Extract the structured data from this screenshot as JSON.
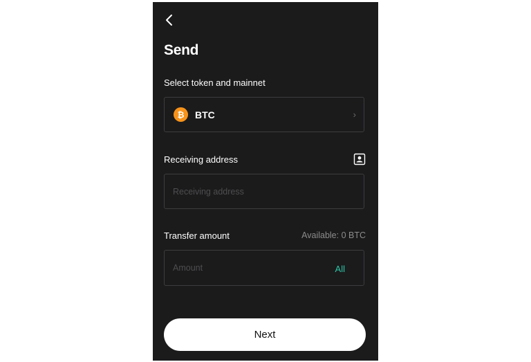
{
  "header": {
    "back_icon": "chevron-left-icon",
    "title": "Send"
  },
  "token": {
    "section_label": "Select token and mainnet",
    "symbol": "BTC",
    "icon": "bitcoin-icon",
    "icon_glyph": "₿",
    "chevron": "›",
    "accent_color": "#f7931a"
  },
  "address": {
    "section_label": "Receiving address",
    "placeholder": "Receiving address",
    "contact_icon": "address-book-icon"
  },
  "amount": {
    "section_label": "Transfer amount",
    "available_text": "Available: 0 BTC",
    "placeholder": "Amount",
    "all_label": "All",
    "all_color": "#2ec4a6"
  },
  "footer": {
    "next_label": "Next"
  }
}
